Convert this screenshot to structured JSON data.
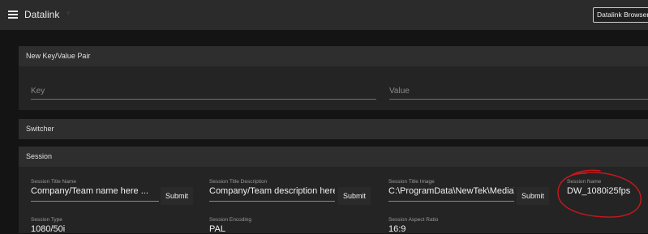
{
  "header": {
    "app_title": "Datalink",
    "caret": "▾",
    "browser_button_label": "Datalink Browser"
  },
  "new_pair": {
    "title": "New Key/Value Pair",
    "key_placeholder": "Key",
    "value_placeholder": "Value"
  },
  "switcher": {
    "title": "Switcher"
  },
  "session": {
    "title": "Session",
    "submit_label": "Submit",
    "fields": [
      {
        "label": "Session Title Name",
        "value": "Company/Team name here ..."
      },
      {
        "label": "Session Title Description",
        "value": "Company/Team description here ..."
      },
      {
        "label": "Session Title Image",
        "value": "C:\\ProgramData\\NewTek\\Media\\Sti"
      },
      {
        "label": "Session Name",
        "value": "DW_1080i25fps"
      },
      {
        "label": "Session Type",
        "value": "1080/50i"
      },
      {
        "label": "Session Encoding",
        "value": "PAL"
      },
      {
        "label": "Session Aspect Ratio",
        "value": "16:9"
      }
    ]
  },
  "annotation_color": "#c8171d"
}
